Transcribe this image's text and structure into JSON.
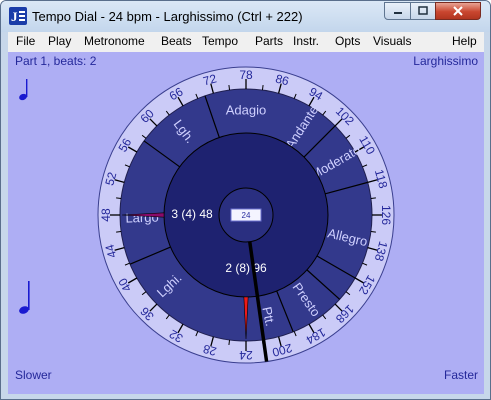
{
  "window": {
    "title": "Tempo Dial - 24 bpm - Larghissimo (Ctrl + 222)",
    "minimize_icon": "minimize-icon",
    "maximize_icon": "maximize-icon",
    "close_icon": "close-icon"
  },
  "menu": [
    "File",
    "Play",
    "Metronome",
    "Beats",
    "Tempo",
    "Parts",
    "Instr.",
    "Opts",
    "Visuals",
    "Help"
  ],
  "status": {
    "part_info": "Part 1, beats: 2",
    "tempo_name": "Larghissimo",
    "slower": "Slower",
    "faster": "Faster"
  },
  "dial": {
    "current_bpm": 24,
    "center_value": "24",
    "tick_labels": [
      "24",
      "28",
      "32",
      "36",
      "40",
      "44",
      "48",
      "52",
      "56",
      "60",
      "66",
      "72",
      "78",
      "86",
      "94",
      "102",
      "110",
      "118",
      "126",
      "138",
      "152",
      "168",
      "184",
      "200"
    ],
    "tempo_names": [
      "Lghi.",
      "Largo",
      "Lgh.",
      "Adagio",
      "Andante",
      "Moderato",
      "Allegro",
      "Presto",
      "Ptt."
    ],
    "markers": [
      {
        "label": "3 (4) 48",
        "bpm": 48,
        "color": "#8a0a6a"
      },
      {
        "label": "2 (8) 96",
        "bpm": 96,
        "color": "#ee1a1a"
      }
    ],
    "colors": {
      "background": "#aeaef4",
      "outer_ring": "#cbcbf7",
      "band": "#33398c",
      "inner": "#1e2270",
      "text": "#24289a"
    }
  },
  "icons": {
    "quarter_note": "quarter-note-icon",
    "half_note": "half-note-icon",
    "app": "app-icon"
  }
}
